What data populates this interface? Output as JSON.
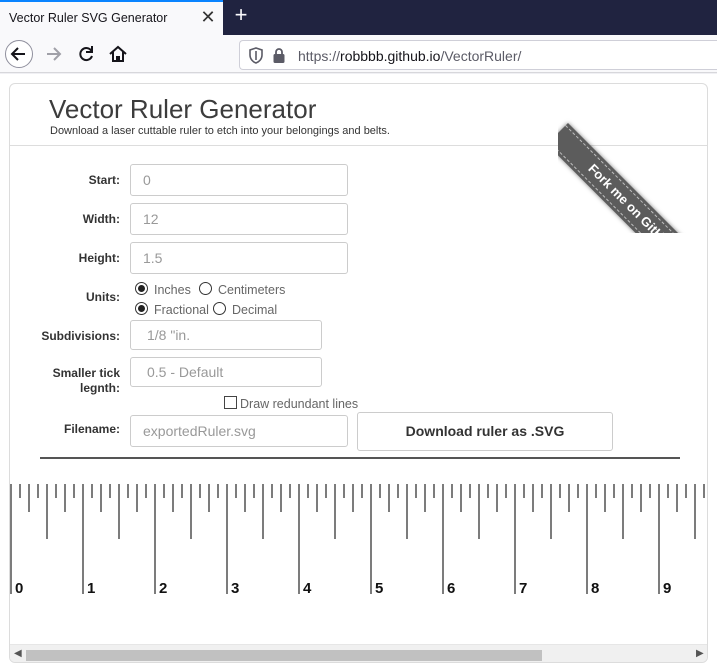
{
  "browser": {
    "tab_title": "Vector Ruler SVG Generator",
    "tab_close": "✕",
    "new_tab": "+",
    "url_prefix": "https://",
    "url_host": "robbbb.github.io",
    "url_path": "/VectorRuler/"
  },
  "header": {
    "title": "Vector Ruler Generator",
    "subtitle": "Download a laser cuttable ruler to etch into your belongings and belts.",
    "ribbon": "Fork me on GitHub"
  },
  "form": {
    "start_label": "Start:",
    "start_value": "0",
    "width_label": "Width:",
    "width_value": "12",
    "height_label": "Height:",
    "height_value": "1.5",
    "units_label": "Units:",
    "unit_inches": "Inches",
    "unit_cm": "Centimeters",
    "mode_fractional": "Fractional",
    "mode_decimal": "Decimal",
    "subdivisions_label": "Subdivisions:",
    "subdivisions_value": "1/8 \"in.",
    "smaller_tick_label_1": "Smaller tick",
    "smaller_tick_label_2": "legnth:",
    "smaller_tick_value": "0.5 - Default",
    "redundant_label": "Draw redundant lines",
    "filename_label": "Filename:",
    "filename_placeholder": "exportedRuler.svg",
    "download_label": "Download ruler as .SVG"
  },
  "ruler": {
    "numbers": [
      "0",
      "1",
      "2",
      "3",
      "4",
      "5",
      "6",
      "7",
      "8",
      "9"
    ],
    "subdivisions_per_unit": 8
  }
}
